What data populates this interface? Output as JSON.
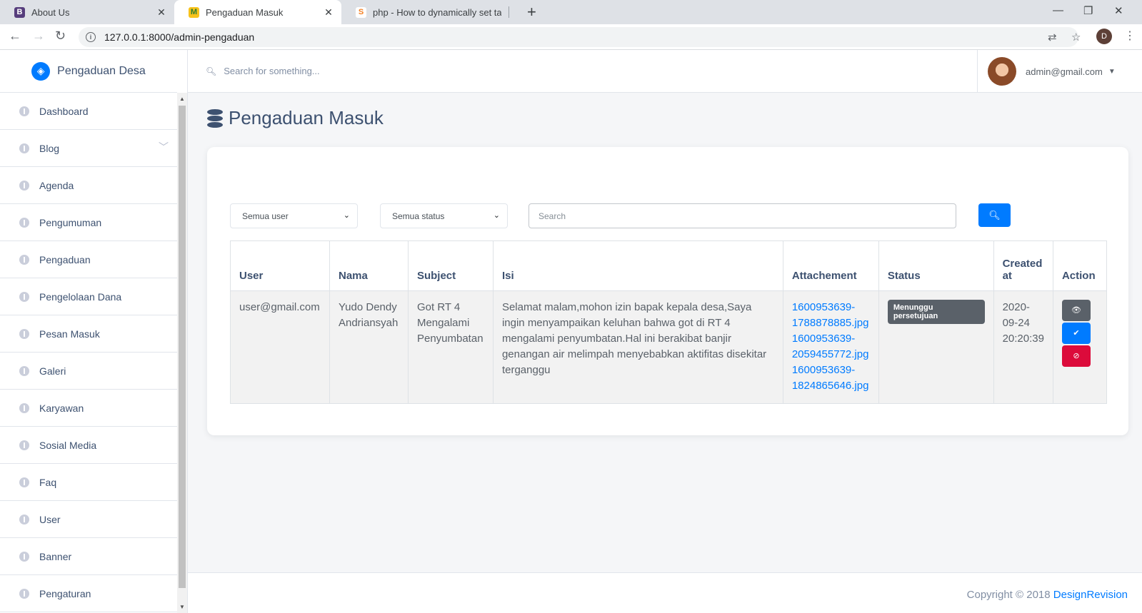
{
  "browser": {
    "tabs": [
      {
        "label": "About Us",
        "favicon": "B",
        "favicon_color": "#563d7c"
      },
      {
        "label": "Pengaduan Masuk",
        "favicon": "M",
        "favicon_color": "#f7c21b"
      },
      {
        "label": "php - How to dynamically set tab",
        "favicon": "S",
        "favicon_color": "#f48024"
      }
    ],
    "url": "127.0.0.1:8000/admin-pengaduan",
    "profile_initial": "D"
  },
  "sidebar": {
    "brand": "Pengaduan Desa",
    "items": [
      {
        "label": "Dashboard"
      },
      {
        "label": "Blog",
        "has_submenu": true
      },
      {
        "label": "Agenda"
      },
      {
        "label": "Pengumuman"
      },
      {
        "label": "Pengaduan"
      },
      {
        "label": "Pengelolaan Dana"
      },
      {
        "label": "Pesan Masuk"
      },
      {
        "label": "Galeri"
      },
      {
        "label": "Karyawan"
      },
      {
        "label": "Sosial Media"
      },
      {
        "label": "Faq"
      },
      {
        "label": "User"
      },
      {
        "label": "Banner"
      },
      {
        "label": "Pengaturan"
      }
    ]
  },
  "topnav": {
    "search_placeholder": "Search for something...",
    "user_email": "admin@gmail.com"
  },
  "page": {
    "title": "Pengaduan Masuk"
  },
  "filters": {
    "user_select": "Semua user",
    "status_select": "Semua status",
    "search_placeholder": "Search"
  },
  "table": {
    "headers": [
      "User",
      "Nama",
      "Subject",
      "Isi",
      "Attachement",
      "Status",
      "Created at",
      "Action"
    ],
    "rows": [
      {
        "user": "user@gmail.com",
        "nama": "Yudo Dendy Andriansyah",
        "subject": "Got RT 4 Mengalami Penyumbatan",
        "isi": "Selamat malam,mohon izin bapak kepala desa,Saya ingin menyampaikan keluhan bahwa got di RT 4 mengalami penyumbatan.Hal ini berakibat banjir genangan air melimpah menyebabkan aktifitas disekitar terganggu",
        "attachments": [
          "1600953639-1788878885.jpg",
          "1600953639-2059455772.jpg",
          "1600953639-1824865646.jpg"
        ],
        "status": "Menunggu persetujuan",
        "created_at": "2020-09-24 20:20:39"
      }
    ]
  },
  "footer": {
    "copyright": "Copyright © 2018",
    "brand_link": "DesignRevision"
  },
  "colors": {
    "primary": "#007bff",
    "danger": "#dc0b3b",
    "secondary": "#5a6169",
    "text": "#3d5170"
  }
}
